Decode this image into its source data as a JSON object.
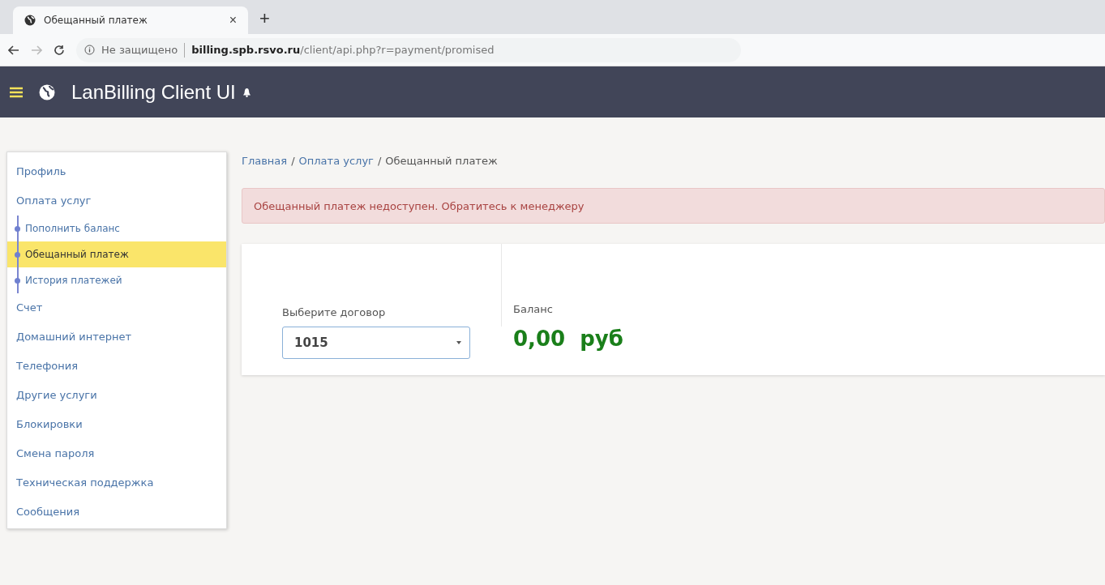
{
  "browser": {
    "tab": {
      "title": "Обещанный платеж",
      "close": "×"
    },
    "new_tab": "+",
    "security": "Не защищено",
    "url": "**billing.spb.rsvo.ru**/client/api.php?r=payment/promised"
  },
  "navbar": {
    "title": "LanBilling Client UI"
  },
  "sidebar": {
    "items": [
      {
        "label": "Профиль",
        "kind": "top",
        "selected": false
      },
      {
        "label": "Оплата услуг",
        "kind": "top",
        "selected": false
      },
      {
        "label": "Пополнить баланс",
        "kind": "sub",
        "selected": false
      },
      {
        "label": "Обещанный платеж",
        "kind": "sub",
        "selected": true
      },
      {
        "label": "История платежей",
        "kind": "sub",
        "selected": false
      },
      {
        "label": "Счет",
        "kind": "top",
        "selected": false
      },
      {
        "label": "Домашний интернет",
        "kind": "top",
        "selected": false
      },
      {
        "label": "Телефония",
        "kind": "top",
        "selected": false
      },
      {
        "label": "Другие услуги",
        "kind": "top",
        "selected": false
      },
      {
        "label": "Блокировки",
        "kind": "top",
        "selected": false
      },
      {
        "label": "Смена пароля",
        "kind": "top",
        "selected": false
      },
      {
        "label": "Техническая поддержка",
        "kind": "top",
        "selected": false
      },
      {
        "label": "Сообщения",
        "kind": "top",
        "selected": false
      }
    ]
  },
  "breadcrumb": {
    "separator": "/",
    "items": [
      {
        "label": "Главная",
        "kind": "link"
      },
      {
        "label": "Оплата услуг",
        "kind": "link"
      },
      {
        "label": "Обещанный платеж",
        "kind": "current"
      }
    ]
  },
  "alert": {
    "text": "Обещанный платеж недоступен. Обратитесь к менеджеру"
  },
  "form": {
    "contract_label": "Выберите договор",
    "contract_value": "1015",
    "balance_label": "Баланс",
    "balance": "0,00  руб"
  }
}
